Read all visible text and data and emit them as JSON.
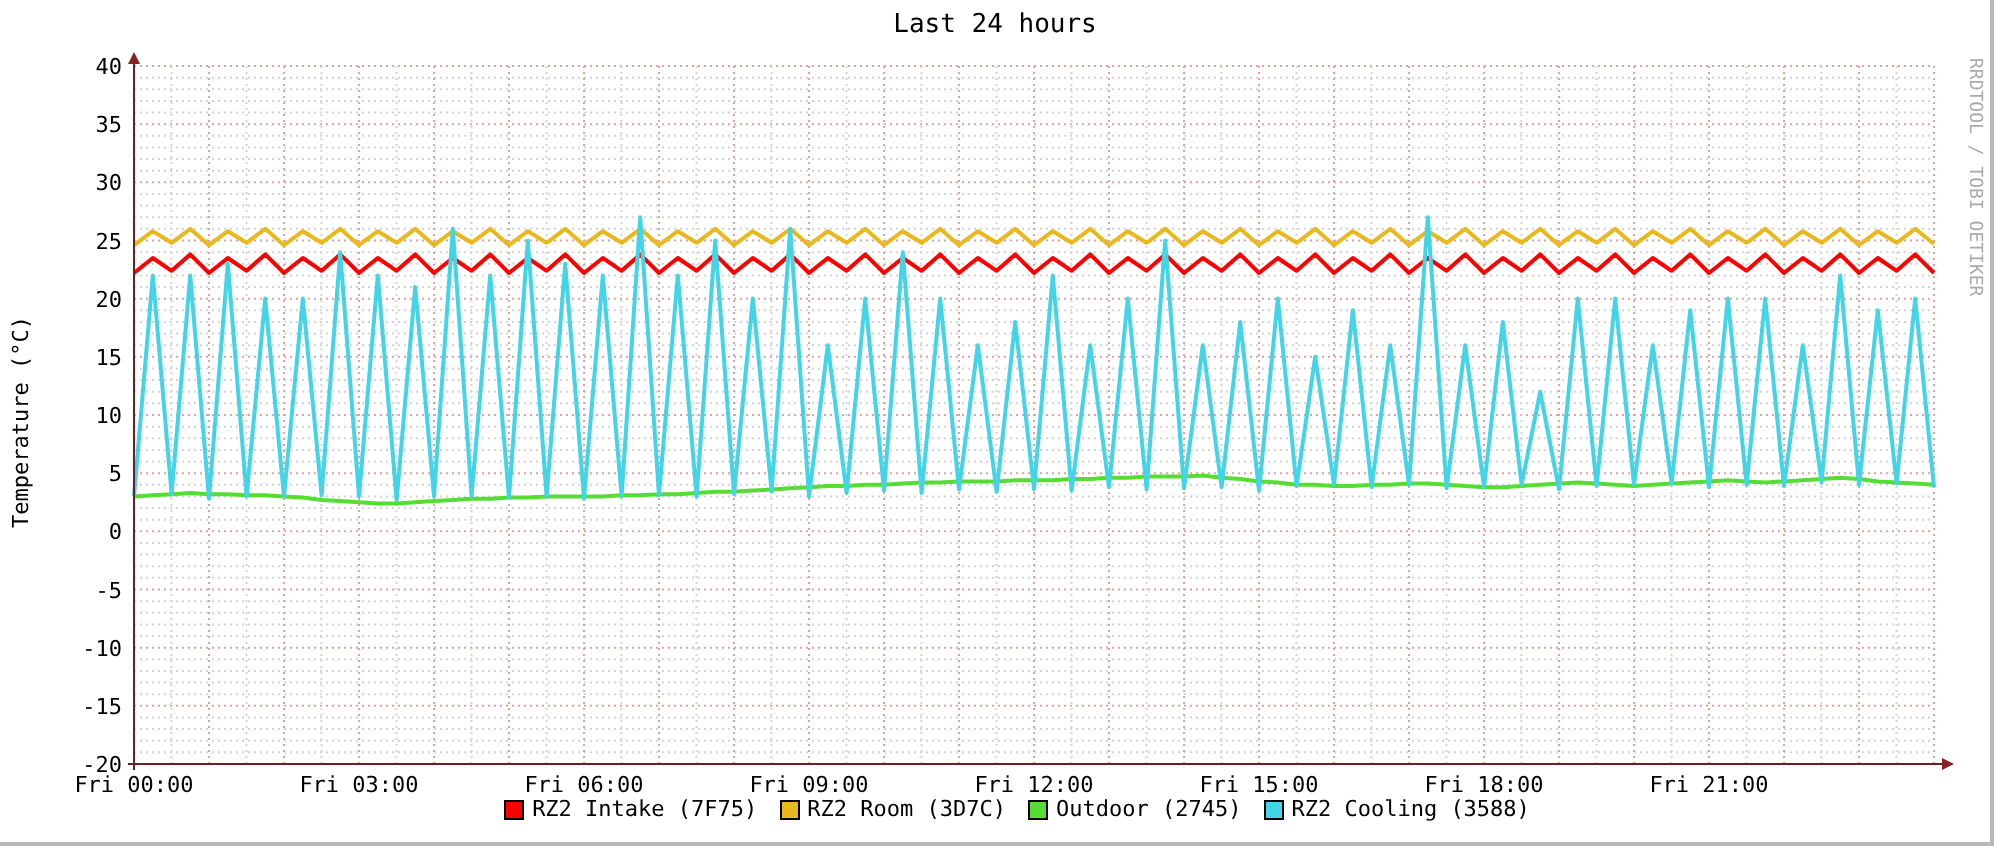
{
  "credit": "RRDTOOL / TOBI OETIKER",
  "chart_data": {
    "type": "line",
    "title": "Last 24 hours",
    "ylabel": "Temperature (°C)",
    "categories": [
      "Fri 00:00",
      null,
      null,
      null,
      null,
      null,
      null,
      null,
      null,
      null,
      null,
      null,
      "Fri 03:00",
      null,
      null,
      null,
      null,
      null,
      null,
      null,
      null,
      null,
      null,
      null,
      "Fri 06:00",
      null,
      null,
      null,
      null,
      null,
      null,
      null,
      null,
      null,
      null,
      null,
      "Fri 09:00",
      null,
      null,
      null,
      null,
      null,
      null,
      null,
      null,
      null,
      null,
      null,
      "Fri 12:00",
      null,
      null,
      null,
      null,
      null,
      null,
      null,
      null,
      null,
      null,
      null,
      "Fri 15:00",
      null,
      null,
      null,
      null,
      null,
      null,
      null,
      null,
      null,
      null,
      null,
      "Fri 18:00",
      null,
      null,
      null,
      null,
      null,
      null,
      null,
      null,
      null,
      null,
      null,
      "Fri 21:00",
      null,
      null,
      null,
      null,
      null,
      null,
      null,
      null,
      null,
      null,
      null,
      null
    ],
    "ylim": [
      -20,
      40
    ],
    "grid": true,
    "yticks": [
      -20,
      -15,
      -10,
      -5,
      0,
      5,
      10,
      15,
      20,
      25,
      30,
      35,
      40
    ],
    "series": [
      {
        "name": "RZ2 Intake (7F75)",
        "color": "#ff0000",
        "values": [
          22.2,
          23.5,
          22.4,
          23.8,
          22.2,
          23.5,
          22.4,
          23.8,
          22.2,
          23.5,
          22.4,
          23.8,
          22.2,
          23.5,
          22.4,
          23.8,
          22.2,
          23.5,
          22.4,
          23.8,
          22.2,
          23.5,
          22.4,
          23.8,
          22.2,
          23.5,
          22.4,
          23.8,
          22.2,
          23.5,
          22.4,
          23.8,
          22.2,
          23.5,
          22.4,
          23.8,
          22.2,
          23.5,
          22.4,
          23.8,
          22.2,
          23.5,
          22.4,
          23.8,
          22.2,
          23.5,
          22.4,
          23.8,
          22.2,
          23.5,
          22.4,
          23.8,
          22.2,
          23.5,
          22.4,
          23.8,
          22.2,
          23.5,
          22.4,
          23.8,
          22.2,
          23.5,
          22.4,
          23.8,
          22.2,
          23.5,
          22.4,
          23.8,
          22.2,
          23.5,
          22.4,
          23.8,
          22.2,
          23.5,
          22.4,
          23.8,
          22.2,
          23.5,
          22.4,
          23.8,
          22.2,
          23.5,
          22.4,
          23.8,
          22.2,
          23.5,
          22.4,
          23.8,
          22.2,
          23.5,
          22.4,
          23.8,
          22.2,
          23.5,
          22.4,
          23.8,
          22.2
        ]
      },
      {
        "name": "RZ2 Room (3D7C)",
        "color": "#e8b81c",
        "values": [
          24.6,
          25.8,
          24.8,
          26.0,
          24.6,
          25.8,
          24.8,
          26.0,
          24.6,
          25.8,
          24.8,
          26.0,
          24.6,
          25.8,
          24.8,
          26.0,
          24.6,
          25.8,
          24.8,
          26.0,
          24.6,
          25.8,
          24.8,
          26.0,
          24.6,
          25.8,
          24.8,
          26.0,
          24.6,
          25.8,
          24.8,
          26.0,
          24.6,
          25.8,
          24.8,
          26.0,
          24.6,
          25.8,
          24.8,
          26.0,
          24.6,
          25.8,
          24.8,
          26.0,
          24.6,
          25.8,
          24.8,
          26.0,
          24.6,
          25.8,
          24.8,
          26.0,
          24.6,
          25.8,
          24.8,
          26.0,
          24.6,
          25.8,
          24.8,
          26.0,
          24.6,
          25.8,
          24.8,
          26.0,
          24.6,
          25.8,
          24.8,
          26.0,
          24.6,
          25.8,
          24.8,
          26.0,
          24.6,
          25.8,
          24.8,
          26.0,
          24.6,
          25.8,
          24.8,
          26.0,
          24.6,
          25.8,
          24.8,
          26.0,
          24.6,
          25.8,
          24.8,
          26.0,
          24.6,
          25.8,
          24.8,
          26.0,
          24.6,
          25.8,
          24.8,
          26.0,
          24.7
        ]
      },
      {
        "name": "Outdoor (2745)",
        "color": "#55dd33",
        "values": [
          3.0,
          3.1,
          3.2,
          3.3,
          3.2,
          3.2,
          3.1,
          3.1,
          3.0,
          2.9,
          2.7,
          2.6,
          2.5,
          2.4,
          2.4,
          2.5,
          2.6,
          2.7,
          2.8,
          2.8,
          2.9,
          2.9,
          3.0,
          3.0,
          3.0,
          3.0,
          3.1,
          3.1,
          3.2,
          3.2,
          3.3,
          3.4,
          3.4,
          3.5,
          3.6,
          3.7,
          3.8,
          3.9,
          3.9,
          4.0,
          4.0,
          4.1,
          4.2,
          4.2,
          4.3,
          4.3,
          4.3,
          4.4,
          4.4,
          4.4,
          4.5,
          4.5,
          4.6,
          4.6,
          4.7,
          4.7,
          4.7,
          4.8,
          4.6,
          4.5,
          4.3,
          4.2,
          4.0,
          4.0,
          3.9,
          3.9,
          4.0,
          4.0,
          4.1,
          4.1,
          4.0,
          3.9,
          3.8,
          3.8,
          3.9,
          4.0,
          4.1,
          4.2,
          4.1,
          4.0,
          3.9,
          4.0,
          4.1,
          4.2,
          4.3,
          4.4,
          4.3,
          4.2,
          4.3,
          4.4,
          4.5,
          4.6,
          4.5,
          4.3,
          4.2,
          4.1,
          4.0
        ]
      },
      {
        "name": "RZ2 Cooling (3588)",
        "color": "#44d4e8",
        "values": [
          3,
          22,
          3.2,
          22,
          2.8,
          23,
          3,
          20,
          3,
          20,
          3.1,
          24,
          3,
          22,
          2.7,
          21,
          3,
          26,
          3,
          22,
          2.9,
          25,
          3,
          23,
          2.8,
          22,
          3,
          27,
          3.1,
          22,
          3,
          25,
          3.2,
          20,
          3.4,
          26,
          3,
          16,
          3.3,
          20,
          3.5,
          24,
          3.3,
          20,
          3.6,
          16,
          3.4,
          18,
          3.6,
          22,
          3.5,
          16,
          3.8,
          20,
          3.6,
          25,
          3.7,
          16,
          3.8,
          18,
          3.5,
          20,
          3.9,
          15,
          4,
          19,
          3.8,
          16,
          4,
          27,
          3.7,
          16,
          3.8,
          18,
          4,
          12,
          3.6,
          20,
          3.9,
          20,
          4,
          16,
          4.1,
          19,
          3.8,
          20,
          4,
          20,
          3.9,
          16,
          4.2,
          22,
          4,
          19,
          4.1,
          20,
          3.8
        ]
      }
    ]
  }
}
